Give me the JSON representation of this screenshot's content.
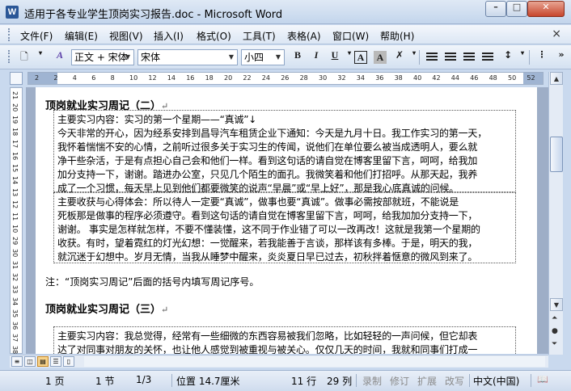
{
  "window": {
    "title": "适用于各专业学生顶岗实习报告.doc - Microsoft Word"
  },
  "menu": [
    "文件(F)",
    "编辑(E)",
    "视图(V)",
    "插入(I)",
    "格式(O)",
    "工具(T)",
    "表格(A)",
    "窗口(W)",
    "帮助(H)"
  ],
  "menu_close": "×",
  "toolbar": {
    "style_value": "正文 + 宋体",
    "font_value": "宋体",
    "size_value": "小四",
    "bold": "B",
    "italic": "I",
    "underline": "U",
    "char_border": "A",
    "char_shade": "A"
  },
  "ruler": {
    "h_ticks": [
      "2",
      "2",
      "4",
      "6",
      "8",
      "10",
      "12",
      "14",
      "16",
      "18",
      "20",
      "22",
      "24",
      "26",
      "28",
      "30",
      "32",
      "34",
      "36",
      "38",
      "40",
      "42",
      "44",
      "46",
      "48",
      "50",
      "52"
    ],
    "v_ticks": [
      "21",
      "20",
      "19",
      "18",
      "17",
      "16",
      "15",
      "14",
      "13",
      "12",
      "11",
      "10",
      "29",
      "30",
      "31",
      "32",
      "33",
      "34",
      "35",
      "36",
      "37",
      "38"
    ]
  },
  "document": {
    "heading1": "顶岗就业实习周记（二）",
    "box1_lines": [
      "主要实习内容：实习的第一个星期——“真诚”↓",
      "今天非常的开心，因为经系安排到昌导汽车租赁企业下通知：今天是九月十日。我工作实习的第一天，",
      "我怀着惴惴不安的心情，之前听过很多关于实习生的传闻，说他们在单位要么被当成透明人，要么就",
      "净干些杂活，于是有点担心自己会和他们一样。看到这句话的请自觉在博客里留下言，呵呵，给我加",
      "加分支持一下，谢谢。踏进办公室，只见几个陌生的面孔。我微笑着和他们打招呼。从那天起，我养",
      "成了一个习惯，每天早上见到他们都要微笑的说声“早晨”或“早上好”，那是我心底真诚的问候。"
    ],
    "box2_lines": [
      "主要收获与心得体会：所以待人一定要“真诚”，做事也要“真诚”。做事必需按部就班，不能说是",
      "死板那是做事的程序必须遵守。看到这句话的请自觉在博客里留下言，呵呵，给我加加分支持一下，",
      "谢谢。  事实是怎样就怎样，不要不懂装懂，这不同于作业错了可以一改再改！这就是我第一个星期的",
      "收获。有时，望着霓红的灯光幻想：一觉醒来，若我能善于言谈，那样该有多棒。于是，明天的我，",
      "就沉迷于幻想中。岁月无情，当我从睡梦中醒来，炎炎夏日早已过去，初秋拌着惬意的微风到来了。"
    ],
    "note": "注：“顶岗实习周记”后面的括号内填写周记序号。",
    "heading2": "顶岗就业实习周记（三）",
    "box3_lines": [
      "主要实习内容：我总觉得，经常有一些细微的东西容易被我们忽略，比如轻轻的一声问候，但它却表",
      "达了对同事对朋友的关怀，也让他人感觉到被重视与被关心。仅仅几天的时间，我就和同事们打成一"
    ]
  },
  "statusbar": {
    "page": "1 页",
    "section": "1 节",
    "page_of": "1/3",
    "position": "位置 14.7厘米",
    "line": "11 行",
    "column": "29 列",
    "rec": "录制",
    "trk": "修订",
    "ext": "扩展",
    "ovr": "改写",
    "lang": "中文(中国)"
  }
}
